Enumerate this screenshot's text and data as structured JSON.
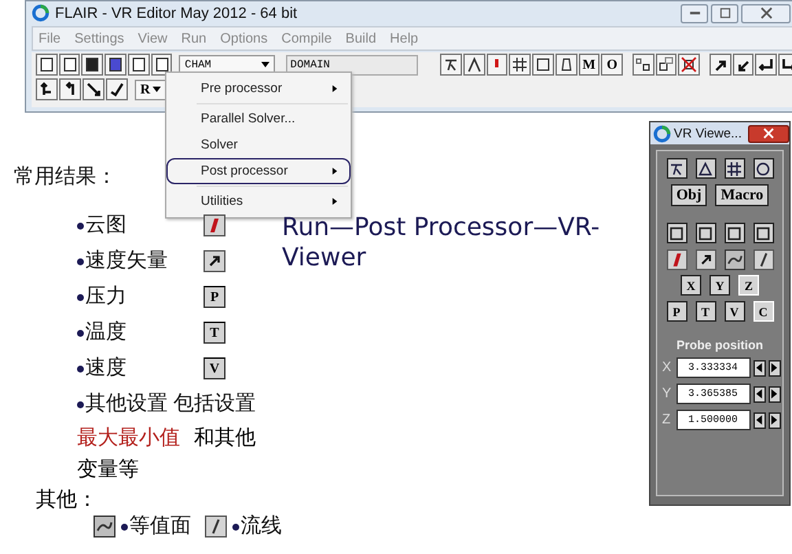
{
  "main_window": {
    "title": "FLAIR - VR Editor May 2012 - 64 bit",
    "menu": [
      "File",
      "Settings",
      "View",
      "Run",
      "Options",
      "Compile",
      "Build",
      "Help"
    ],
    "toolbar": {
      "combo": "CHAM",
      "field": "DOMAIN",
      "letter_buttons": [
        "M",
        "O"
      ],
      "row2_combo": "R"
    }
  },
  "run_menu": [
    {
      "label": "Pre processor",
      "submenu": true,
      "highlighted": false
    },
    {
      "label": "Parallel Solver...",
      "submenu": false,
      "highlighted": false
    },
    {
      "label": "Solver",
      "submenu": false,
      "highlighted": false
    },
    {
      "label": "Post processor",
      "submenu": true,
      "highlighted": true
    },
    {
      "label": "Utilities",
      "submenu": true,
      "highlighted": false
    }
  ],
  "vr_viewer": {
    "title": "VR Viewe...",
    "text_buttons": [
      "Obj",
      "Macro"
    ],
    "axis_buttons": [
      {
        "label": "X",
        "selected": false
      },
      {
        "label": "Y",
        "selected": false
      },
      {
        "label": "Z",
        "selected": true
      }
    ],
    "variable_buttons": [
      {
        "label": "P",
        "selected": false
      },
      {
        "label": "T",
        "selected": false
      },
      {
        "label": "V",
        "selected": false
      },
      {
        "label": "C",
        "selected": true
      }
    ],
    "probe_label": "Probe position",
    "probe_fields": [
      {
        "axis": "X",
        "value": "3.333334"
      },
      {
        "axis": "Y",
        "value": "3.365385"
      },
      {
        "axis": "Z",
        "value": "1.500000"
      }
    ]
  },
  "path_caption": "Run—Post Processor—VR-Viewer",
  "notes": {
    "heading": "常用结果：",
    "items": [
      {
        "text": "云图",
        "kind": "contour"
      },
      {
        "text": "速度矢量",
        "kind": "vector"
      },
      {
        "text": "压力",
        "kind": "letter",
        "letter": "P"
      },
      {
        "text": "温度",
        "kind": "letter",
        "letter": "T"
      },
      {
        "text": "速度",
        "kind": "letter",
        "letter": "V"
      },
      {
        "text": "其他设置 包括设置",
        "kind": "plain"
      }
    ],
    "extra_lines": [
      [
        {
          "text": "最大最小值",
          "kind": "highlight"
        },
        {
          "text": "和其他",
          "kind": "plain"
        }
      ],
      [
        {
          "text": "变量等",
          "kind": "plain"
        }
      ]
    ],
    "others_heading": "其他：",
    "others": [
      {
        "text": "等值面",
        "kind": "iso"
      },
      {
        "text": "流线",
        "kind": "stream"
      }
    ]
  }
}
